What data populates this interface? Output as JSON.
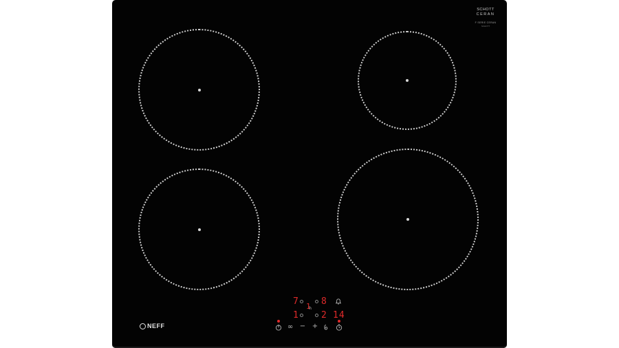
{
  "appliance": {
    "brand_logo": "NEFF",
    "glass_badge": {
      "line1": "SCHOTT",
      "line2": "CERAN",
      "line3": "F SERIE CERAN",
      "line4": "SCHOTT"
    },
    "colors": {
      "glass": "#030303",
      "zone_outline": "#cfcfcf",
      "display_red": "#e02a2a",
      "control_gray": "#b7b7b7"
    }
  },
  "zones": {
    "top_left": {
      "name": "cooking-zone-front-left"
    },
    "top_right": {
      "name": "cooking-zone-rear-right"
    },
    "bottom_left": {
      "name": "cooking-zone-front-left-2"
    },
    "bottom_right": {
      "name": "cooking-zone-front-right"
    }
  },
  "display": {
    "zone_upper_left": "7",
    "zone_upper_center": "1",
    "zone_upper_right": "8",
    "zone_lower_left": "1",
    "zone_lower_center": "2",
    "timer": "14"
  },
  "controls": {
    "info_icon": "info-icon",
    "power_icon": "power-symbol-icon",
    "minus": "−",
    "plus": "+",
    "child_lock_icon": "child-lock-icon",
    "timer_icon": "timer-icon",
    "bell_icon": "bell-icon",
    "infinity": "∞",
    "zone_select_hint": "h"
  }
}
